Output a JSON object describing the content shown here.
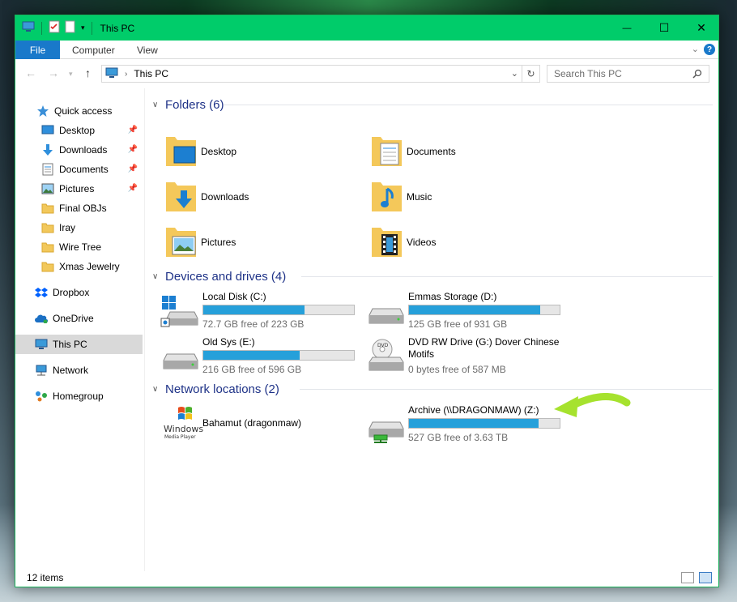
{
  "window": {
    "title": "This PC",
    "minimize": "—",
    "maximize": "☐",
    "close": "✕"
  },
  "ribbon": {
    "tabs": [
      "File",
      "Computer",
      "View"
    ],
    "help": "?"
  },
  "address": {
    "path": "This PC",
    "search_placeholder": "Search This PC"
  },
  "nav": {
    "items": [
      {
        "label": "Quick access",
        "icon": "star-icon"
      },
      {
        "label": "Desktop",
        "icon": "desktop-icon",
        "pinned": true
      },
      {
        "label": "Downloads",
        "icon": "download-icon",
        "pinned": true
      },
      {
        "label": "Documents",
        "icon": "documents-icon",
        "pinned": true
      },
      {
        "label": "Pictures",
        "icon": "pictures-icon",
        "pinned": true
      },
      {
        "label": "Final OBJs",
        "icon": "folder-icon"
      },
      {
        "label": "Iray",
        "icon": "folder-icon"
      },
      {
        "label": "Wire Tree",
        "icon": "folder-icon"
      },
      {
        "label": "Xmas Jewelry",
        "icon": "folder-icon"
      },
      {
        "label": "Dropbox",
        "icon": "dropbox-icon"
      },
      {
        "label": "OneDrive",
        "icon": "onedrive-icon"
      },
      {
        "label": "This PC",
        "icon": "computer-icon",
        "selected": true
      },
      {
        "label": "Network",
        "icon": "network-icon"
      },
      {
        "label": "Homegroup",
        "icon": "homegroup-icon"
      }
    ]
  },
  "groups": {
    "folders": "Folders (6)",
    "devices": "Devices and drives (4)",
    "network": "Network locations (2)"
  },
  "folders": [
    {
      "label": "Desktop"
    },
    {
      "label": "Documents"
    },
    {
      "label": "Downloads"
    },
    {
      "label": "Music"
    },
    {
      "label": "Pictures"
    },
    {
      "label": "Videos"
    }
  ],
  "drives": [
    {
      "name": "Local Disk (C:)",
      "free": "72.7 GB free of 223 GB",
      "used_fraction": 0.67
    },
    {
      "name": "Emmas Storage (D:)",
      "free": "125 GB free of 931 GB",
      "used_fraction": 0.87
    },
    {
      "name": "Old Sys (E:)",
      "free": "216 GB free of 596 GB",
      "used_fraction": 0.64
    },
    {
      "name": "DVD RW Drive (G:) Dover Chinese",
      "name2": "Motifs",
      "free": "0 bytes free of 587 MB"
    }
  ],
  "network_locations": [
    {
      "name": "Bahamut (dragonmaw)",
      "logo_text": "Windows",
      "logo_sub": "Media Player"
    },
    {
      "name": "Archive (\\\\DRAGONMAW) (Z:)",
      "free": "527 GB free of 3.63 TB",
      "used_fraction": 0.86
    }
  ],
  "status": {
    "items": "12 items"
  },
  "colors": {
    "titlebar": "#00cc6a",
    "file_tab": "#1979ca",
    "group_header": "#1e3287",
    "bar_fill": "#26a0da",
    "arrow": "#a6e22e"
  }
}
